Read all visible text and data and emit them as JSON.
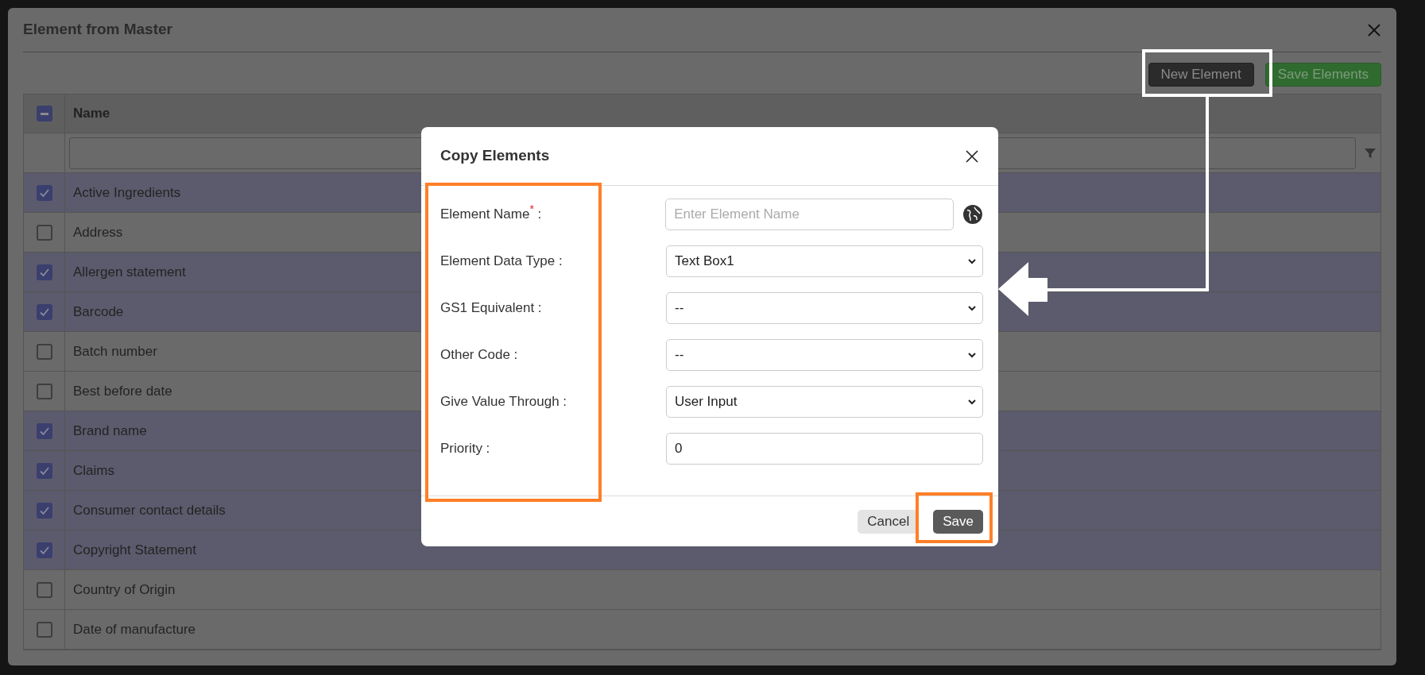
{
  "dialog": {
    "title": "Element from Master",
    "toolbar": [
      {
        "label": "New Element",
        "kind": "dark"
      },
      {
        "label": "Save Elements",
        "kind": "success"
      }
    ]
  },
  "table": {
    "header_checkbox": {
      "indeterminate": true
    },
    "columns": [
      "Name"
    ],
    "rows": [
      {
        "name": "Active Ingredients",
        "checked": true
      },
      {
        "name": "Address",
        "checked": false
      },
      {
        "name": "Allergen statement",
        "checked": true
      },
      {
        "name": "Barcode",
        "checked": true
      },
      {
        "name": "Batch number",
        "checked": false
      },
      {
        "name": "Best before date",
        "checked": false
      },
      {
        "name": "Brand name",
        "checked": true
      },
      {
        "name": "Claims",
        "checked": true
      },
      {
        "name": "Consumer contact details",
        "checked": true
      },
      {
        "name": "Copyright Statement",
        "checked": true
      },
      {
        "name": "Country of Origin",
        "checked": false
      },
      {
        "name": "Date of manufacture",
        "checked": false
      }
    ]
  },
  "modal": {
    "title": "Copy Elements",
    "fields": [
      {
        "kind": "input",
        "label": "Element Name$^{*}$ :",
        "placeholder": "Enter Element Name",
        "globe": true
      },
      {
        "kind": "select",
        "label": "Element Data Type :",
        "value": "Text Box1"
      },
      {
        "kind": "select",
        "label": "GS1 Equivalent :",
        "value": "--"
      },
      {
        "kind": "select",
        "label": "Other Code :",
        "value": "--"
      },
      {
        "kind": "select",
        "label": "Give Value Through :",
        "value": "User Input"
      },
      {
        "kind": "input",
        "label": "Priority :",
        "value": "0"
      }
    ],
    "buttons": [
      {
        "label": "Cancel",
        "kind": "secondary"
      },
      {
        "label": "Save",
        "kind": "primary"
      }
    ]
  }
}
